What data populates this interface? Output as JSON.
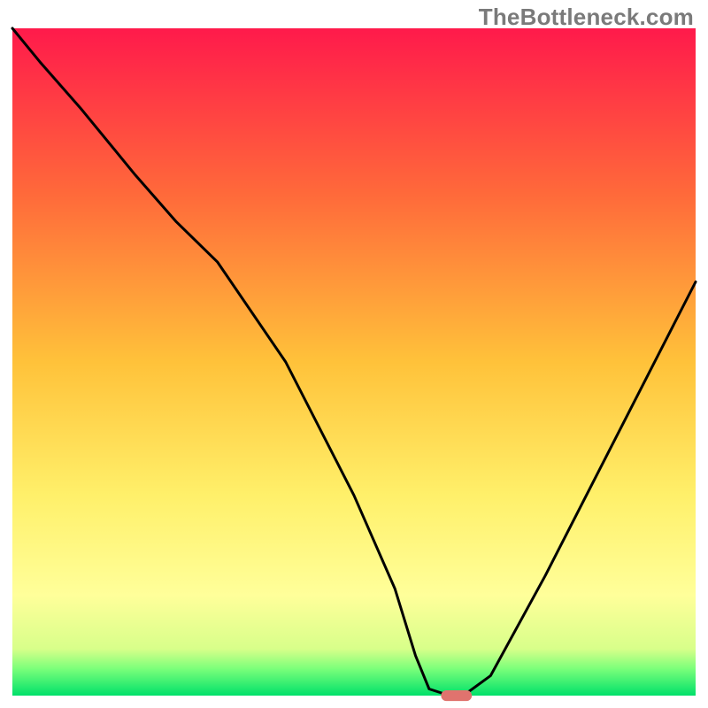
{
  "watermark": "TheBottleneck.com",
  "chart_data": {
    "type": "line",
    "title": "",
    "xlabel": "",
    "ylabel": "",
    "xlim": [
      0,
      100
    ],
    "ylim": [
      0,
      100
    ],
    "grid": false,
    "legend": false,
    "axes_visible": false,
    "background": {
      "type": "vertical-gradient",
      "stops": [
        {
          "y": 0,
          "color": "#ff1a4b"
        },
        {
          "y": 25,
          "color": "#ff6a3a"
        },
        {
          "y": 50,
          "color": "#ffc23a"
        },
        {
          "y": 70,
          "color": "#fff06a"
        },
        {
          "y": 85,
          "color": "#ffff9a"
        },
        {
          "y": 93,
          "color": "#d8ff8a"
        },
        {
          "y": 96,
          "color": "#7aff7a"
        },
        {
          "y": 100,
          "color": "#00e06a"
        }
      ]
    },
    "series": [
      {
        "name": "bottleneck-curve",
        "color": "#000000",
        "stroke_width": 3,
        "x": [
          0,
          4,
          10,
          18,
          24,
          30,
          40,
          50,
          56,
          59,
          61,
          64,
          66,
          70,
          78,
          90,
          100
        ],
        "y": [
          100,
          95,
          88,
          78,
          71,
          65,
          50,
          30,
          16,
          6,
          1,
          0,
          0,
          3,
          18,
          42,
          62
        ]
      }
    ],
    "annotations": [
      {
        "name": "target-marker",
        "type": "rounded-rect",
        "x_center": 65,
        "y_center": 0,
        "width_pct": 4.5,
        "height_pct": 1.6,
        "color": "#e0736e"
      }
    ]
  }
}
